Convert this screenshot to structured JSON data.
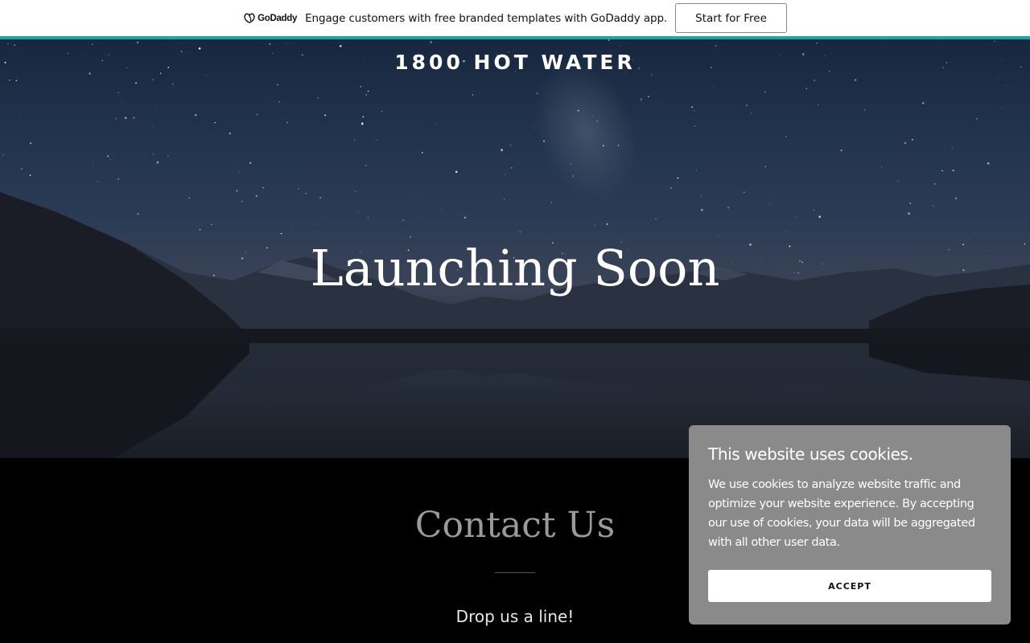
{
  "promo": {
    "brand": "GoDaddy",
    "message": "Engage customers with free branded templates with GoDaddy app.",
    "button_label": "Start for Free",
    "accent_color": "#1ba8a0"
  },
  "hero": {
    "site_title": "1800 HOT WATER",
    "heading": "Launching Soon"
  },
  "contact": {
    "heading": "Contact Us",
    "subheading": "Drop us a line!"
  },
  "cookie": {
    "title": "This website uses cookies.",
    "body": "We use cookies to analyze website traffic and optimize your website experience. By accepting our use of cookies, your data will be aggregated with all other user data.",
    "accept_label": "ACCEPT"
  }
}
